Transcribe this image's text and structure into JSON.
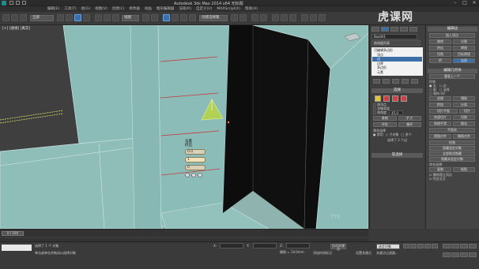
{
  "app": {
    "title": "Autodesk 3ds Max  2014 x64    无标题",
    "watermark": "虎课网"
  },
  "menu": {
    "items": [
      "编辑(E)",
      "工具(T)",
      "组(G)",
      "视图(V)",
      "创建(C)",
      "修改器",
      "动画",
      "图形编辑器",
      "渲染(R)",
      "自定义(U)",
      "MAXScript(X)",
      "帮助(H)"
    ]
  },
  "toolbar": {
    "selection_filter": "全部",
    "view_dropdown": "视图",
    "named_selection": "创建选择集"
  },
  "viewport": {
    "label": "[+] [透视] [真实]"
  },
  "gizmo_menu": {
    "title1": "设置",
    "title2": "挤出",
    "field1": "0.0",
    "field2": "1",
    "field3": "0"
  },
  "command_panel": {
    "object_name": "Box001",
    "modifier_list": "修改器列表",
    "stack": [
      "可编辑多边形",
      "顶点",
      "边",
      "边界",
      "多边形",
      "元素"
    ],
    "selected_index": 2,
    "selection_header": "选择",
    "check_by_vertex": "按顶点",
    "check_ignore_backfacing": "忽略背面",
    "check_by_angle": "按角度",
    "angle_value": "45.0",
    "shrink": "收缩",
    "grow": "扩大",
    "ring": "环形",
    "loop": "循环",
    "preview_selection": "预览选择",
    "preview_off": "禁用",
    "preview_sub": "子对象",
    "preview_multi": "多个",
    "selected_status": "选择了 2 个边",
    "soft_selection": "软选择"
  },
  "rollout": {
    "edit_geometry": "编辑几何体",
    "repeat_last": "重复上一个",
    "constraints": "约束",
    "none": "无",
    "edge": "边",
    "face": "面",
    "normal": "法线",
    "preserve_uvs": "保持 UV",
    "create": "创建",
    "collapse": "塌陷",
    "attach": "附加",
    "detach": "分离",
    "slice_plane": "切片平面",
    "split": "分割",
    "slice": "切片",
    "reset_plane": "重置平面",
    "quickslice": "快速切片",
    "cut": "切割",
    "meshsmooth": "网格平滑",
    "tessellate": "细化",
    "make_planar": "平面化",
    "view_align": "视图对齐",
    "grid_align": "栅格对齐",
    "relax": "松弛",
    "hide_selected": "隐藏选定对象",
    "unhide_all": "全部取消隐藏",
    "hide_unselected": "隐藏未选定对象",
    "named_selections": "命名选择:",
    "copy": "复制",
    "paste": "粘贴",
    "delete_isolated": "删除孤立顶点",
    "full_interactivity": "完全交互",
    "edit_edges": "编辑边",
    "insert_vertex": "插入顶点",
    "remove": "移除",
    "extrude": "挤出",
    "weld": "焊接",
    "chamfer": "切角",
    "target_weld": "目标焊接",
    "bridge": "桥",
    "connect": "连接",
    "subdivide_header": "细分曲面"
  },
  "timeline": {
    "frame": "0 / 100"
  },
  "status": {
    "selected": "选择了 1 个 对象",
    "prompt": "单击或单击并拖动以选择对象",
    "x_label": "X:",
    "y_label": "Y:",
    "z_label": "Z:",
    "grid": "栅格 = 10.0mm",
    "auto_key": "自动关键点",
    "selected_obj": "选定对象",
    "set_key": "设置关键点",
    "key_filter": "关键点过滤器...",
    "add_time_tag": "添加时间标记"
  },
  "colors": {
    "viewport_bg": "#8fb3ae",
    "wall": "#8cbcb8",
    "dark_face": "#0e0e0e",
    "gizmo": "#b6d44a",
    "accent_blue": "#3c6fa8",
    "edge_red": "#c8383a"
  }
}
